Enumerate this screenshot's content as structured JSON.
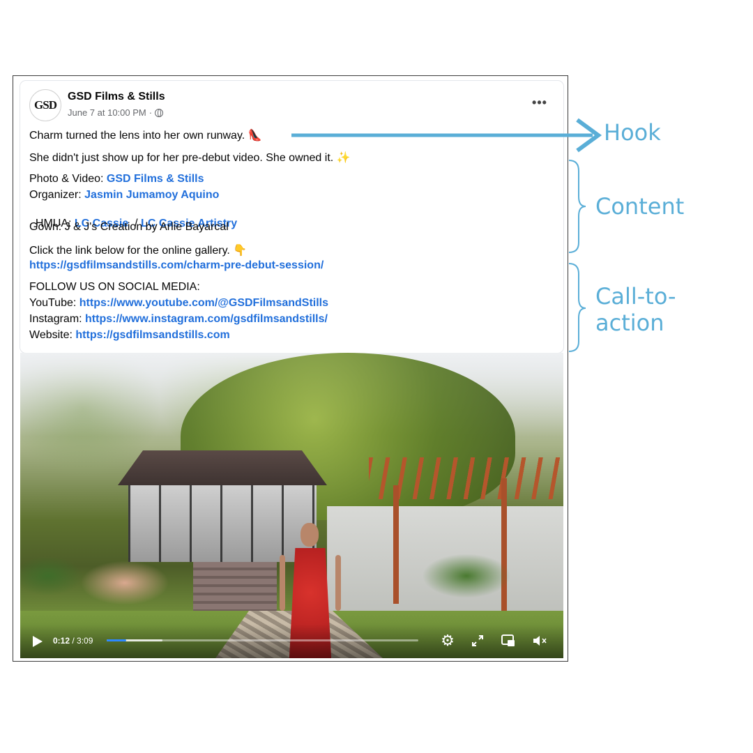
{
  "post": {
    "page_name": "GSD Films & Stills",
    "date": "June 7 at 10:00 PM",
    "date_sep": "·",
    "avatar_text": "GSD",
    "more": "•••",
    "hook": "Charm turned the lens into her own runway. 👠",
    "intro": "She didn't just show up for her pre-debut video. She owned it. ✨",
    "credits": [
      {
        "label": "Photo & Video: ",
        "links": [
          "GSD Films & Stills"
        ]
      },
      {
        "label": "Organizer: ",
        "links": [
          "Jasmin Jumamoy Aquino"
        ]
      },
      {
        "label": "HMUA: ",
        "links": [
          "LC Cassie",
          "LC Cassie Artistry"
        ],
        "sep": "  / "
      },
      {
        "label": "Gown: J & J's Creation by Arlie Bayarcal",
        "links": []
      }
    ],
    "gallery_text": "Click the link below for the online gallery. 👇",
    "gallery_url": "https://gsdfilmsandstills.com/charm-pre-debut-session/",
    "follow_heading": "FOLLOW US ON SOCIAL MEDIA:",
    "social": [
      {
        "label": "YouTube: ",
        "url": "https://www.youtube.com/@GSDFilmsandStills"
      },
      {
        "label": "Instagram: ",
        "url": "https://www.instagram.com/gsdfilmsandstills/"
      },
      {
        "label": "Website: ",
        "url": "https://gsdfilmsandstills.com"
      }
    ]
  },
  "video": {
    "current_time": "0:12",
    "total_time": "/ 3:09",
    "progress_fraction": 0.063,
    "buffer_fraction": 0.18,
    "icons": [
      "play-icon",
      "gear-icon",
      "expand-icon",
      "pip-icon",
      "mute-icon"
    ]
  },
  "annotations": {
    "hook": "Hook",
    "content": "Content",
    "cta_line1": "Call-to-",
    "cta_line2": "action",
    "color": "#5aaed7"
  },
  "colors": {
    "link": "#216fdb",
    "progress": "#2d88ff"
  }
}
